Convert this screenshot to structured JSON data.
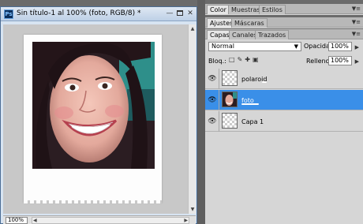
{
  "document": {
    "app_icon": "Ps",
    "title": "Sin título-1 al 100% (foto, RGB/8) *",
    "zoom": "100%"
  },
  "panels": {
    "top_tabs": [
      "Color",
      "Muestras",
      "Estilos"
    ],
    "mid_tabs": [
      "Ajustes",
      "Máscaras"
    ],
    "layer_tabs": [
      "Capas",
      "Canales",
      "Trazados"
    ]
  },
  "layers_panel": {
    "blend_mode": "Normal",
    "opacity_label": "Opacidad:",
    "opacity": "100%",
    "lock_label": "Bloq.:",
    "fill_label": "Relleno:",
    "fill": "100%",
    "layers": [
      {
        "name": "polaroid",
        "selected": false
      },
      {
        "name": "foto",
        "selected": true
      },
      {
        "name": "Capa 1",
        "selected": false
      }
    ]
  },
  "colors": {
    "selection": "#3a8fe8",
    "canvas": "#c8c8c8",
    "panel": "#d6d6d6"
  }
}
